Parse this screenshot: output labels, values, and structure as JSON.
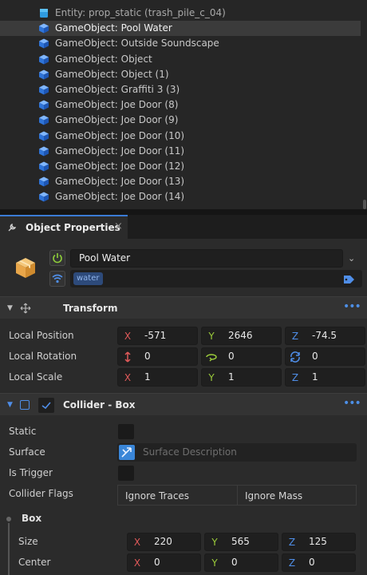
{
  "hierarchy": {
    "items": [
      {
        "label": "Entity: prop_static (trash_pile_c_04)",
        "kind": "entity",
        "selected": false
      },
      {
        "label": "GameObject: Pool Water",
        "kind": "gameobject",
        "selected": true
      },
      {
        "label": "GameObject: Outside Soundscape",
        "kind": "gameobject",
        "selected": false
      },
      {
        "label": "GameObject: Object",
        "kind": "gameobject",
        "selected": false
      },
      {
        "label": "GameObject: Object (1)",
        "kind": "gameobject",
        "selected": false
      },
      {
        "label": "GameObject: Graffiti 3 (3)",
        "kind": "gameobject",
        "selected": false
      },
      {
        "label": "GameObject: Joe Door (8)",
        "kind": "gameobject",
        "selected": false
      },
      {
        "label": "GameObject: Joe Door (9)",
        "kind": "gameobject",
        "selected": false
      },
      {
        "label": "GameObject: Joe Door (10)",
        "kind": "gameobject",
        "selected": false
      },
      {
        "label": "GameObject: Joe Door (11)",
        "kind": "gameobject",
        "selected": false
      },
      {
        "label": "GameObject: Joe Door (12)",
        "kind": "gameobject",
        "selected": false
      },
      {
        "label": "GameObject: Joe Door (13)",
        "kind": "gameobject",
        "selected": false
      },
      {
        "label": "GameObject: Joe Door (14)",
        "kind": "gameobject",
        "selected": false
      }
    ]
  },
  "tab": {
    "label": "Object Properties",
    "close": "×",
    "icon": "wrench-icon"
  },
  "object": {
    "name": "Pool Water",
    "tag": "water",
    "icon": "package-icon",
    "enable_icon": "power-icon",
    "network_icon": "network-icon"
  },
  "transform": {
    "title": "Transform",
    "more": "•••",
    "local_position": {
      "label": "Local Position",
      "x": "-571",
      "y": "2646",
      "z": "-74.5"
    },
    "local_rotation": {
      "label": "Local Rotation",
      "p": "0",
      "y": "0",
      "r": "0"
    },
    "local_scale": {
      "label": "Local Scale",
      "x": "1",
      "y": "1",
      "z": "1"
    }
  },
  "collider": {
    "title": "Collider - Box",
    "more": "•••",
    "static_label": "Static",
    "surface_label": "Surface",
    "surface_placeholder": "Surface Description",
    "is_trigger_label": "Is Trigger",
    "flags_label": "Collider Flags",
    "flag_ignore_traces": "Ignore Traces",
    "flag_ignore_mass": "Ignore Mass",
    "box_group": "Box",
    "size": {
      "label": "Size",
      "x": "220",
      "y": "565",
      "z": "125"
    },
    "center": {
      "label": "Center",
      "x": "0",
      "y": "0",
      "z": "0"
    }
  },
  "axes": {
    "x": "X",
    "y": "Y",
    "z": "Z"
  },
  "colors": {
    "accent": "#3a7bd5",
    "axis_x": "#e05a5a",
    "axis_y": "#9bcc3a",
    "axis_z": "#4f8ee8"
  }
}
